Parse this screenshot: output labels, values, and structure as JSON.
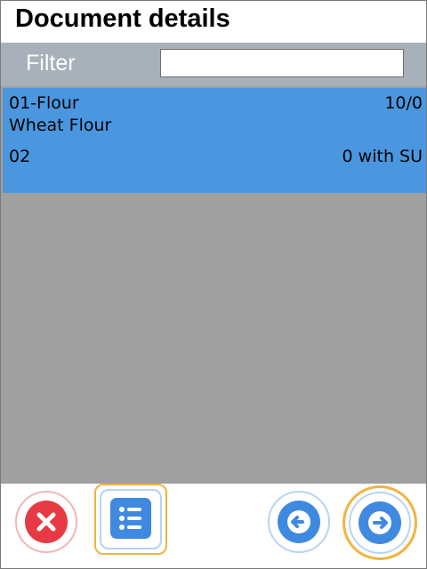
{
  "header": {
    "title": "Document details"
  },
  "filter": {
    "label": "Filter",
    "value": "",
    "placeholder": ""
  },
  "items": [
    {
      "code_name": "01-Flour",
      "quantity": "10/0",
      "description": "Wheat Flour",
      "sub_code": "02",
      "su_text": "0 with SU"
    }
  ],
  "colors": {
    "selected_row": "#4a97e0",
    "list_background": "#a0a0a0",
    "filter_bar": "#a8b1b9",
    "primary_button": "#3f8ae0",
    "close_button": "#e83a44",
    "focus_outline": "#f1b43e"
  },
  "toolbar": {
    "close_icon": "close-icon",
    "list_icon": "list-icon",
    "back_icon": "arrow-left-icon",
    "next_icon": "arrow-right-icon"
  }
}
